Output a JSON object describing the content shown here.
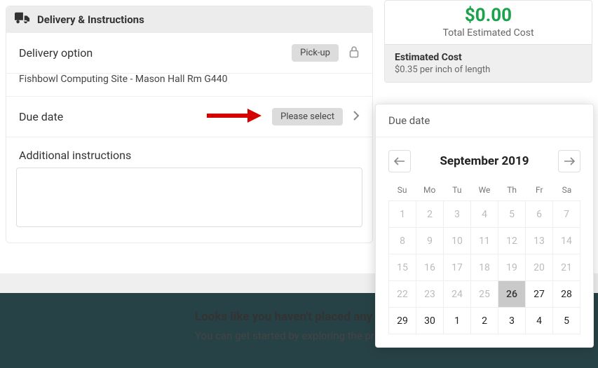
{
  "card": {
    "title": "Delivery & Instructions",
    "deliveryOption": {
      "label": "Delivery option",
      "value": "Pick-up"
    },
    "site": "Fishbowl Computing Site - Mason Hall Rm G440",
    "dueDate": {
      "label": "Due date",
      "value": "Please select"
    },
    "instructions": {
      "label": "Additional instructions",
      "value": ""
    }
  },
  "cost": {
    "amount": "$0.00",
    "caption": "Total Estimated Cost",
    "estTitle": "Estimated Cost",
    "estSub": "$0.35 per inch of length"
  },
  "msg": {
    "heading": "Looks like you haven't placed any o",
    "sub": "You can get started by exploring the pro"
  },
  "datepicker": {
    "title": "Due date",
    "month": "September 2019",
    "dow": [
      "Su",
      "Mo",
      "Tu",
      "We",
      "Th",
      "Fr",
      "Sa"
    ],
    "days": [
      {
        "n": "1",
        "s": "disabled"
      },
      {
        "n": "2",
        "s": "disabled"
      },
      {
        "n": "3",
        "s": "disabled"
      },
      {
        "n": "4",
        "s": "disabled"
      },
      {
        "n": "5",
        "s": "disabled"
      },
      {
        "n": "6",
        "s": "disabled"
      },
      {
        "n": "7",
        "s": "disabled"
      },
      {
        "n": "8",
        "s": "disabled"
      },
      {
        "n": "9",
        "s": "disabled"
      },
      {
        "n": "10",
        "s": "disabled"
      },
      {
        "n": "11",
        "s": "disabled"
      },
      {
        "n": "12",
        "s": "disabled"
      },
      {
        "n": "13",
        "s": "disabled"
      },
      {
        "n": "14",
        "s": "disabled"
      },
      {
        "n": "15",
        "s": "disabled"
      },
      {
        "n": "16",
        "s": "disabled"
      },
      {
        "n": "17",
        "s": "disabled"
      },
      {
        "n": "18",
        "s": "disabled"
      },
      {
        "n": "19",
        "s": "disabled"
      },
      {
        "n": "20",
        "s": "disabled"
      },
      {
        "n": "21",
        "s": "disabled"
      },
      {
        "n": "22",
        "s": "disabled"
      },
      {
        "n": "23",
        "s": "disabled"
      },
      {
        "n": "24",
        "s": "disabled"
      },
      {
        "n": "25",
        "s": "disabled"
      },
      {
        "n": "26",
        "s": "today"
      },
      {
        "n": "27",
        "s": "enabled"
      },
      {
        "n": "28",
        "s": "enabled"
      },
      {
        "n": "29",
        "s": "enabled"
      },
      {
        "n": "30",
        "s": "enabled"
      },
      {
        "n": "1",
        "s": "enabled"
      },
      {
        "n": "2",
        "s": "enabled"
      },
      {
        "n": "3",
        "s": "enabled"
      },
      {
        "n": "4",
        "s": "enabled"
      },
      {
        "n": "5",
        "s": "enabled"
      }
    ]
  }
}
